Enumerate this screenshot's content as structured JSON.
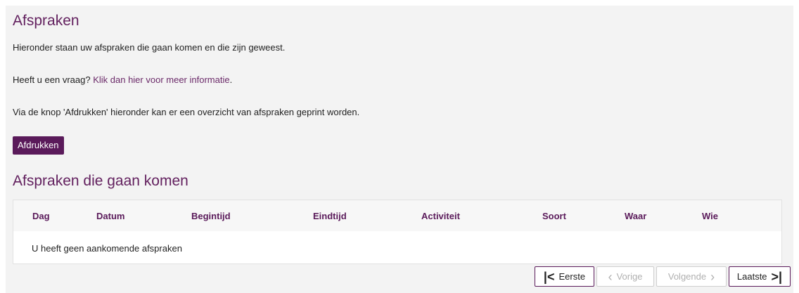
{
  "page": {
    "title": "Afspraken",
    "intro": "Hieronder staan uw afspraken die gaan komen en die zijn geweest.",
    "question_prefix": "Heeft u een vraag? ",
    "question_link": "Klik dan hier voor meer informatie",
    "question_suffix": ".",
    "print_info": "Via de knop 'Afdrukken' hieronder kan er een overzicht van afspraken geprint worden.",
    "print_button": "Afdrukken"
  },
  "upcoming": {
    "title": "Afspraken die gaan komen",
    "columns": [
      "Dag",
      "Datum",
      "Begintijd",
      "Eindtijd",
      "Activiteit",
      "Soort",
      "Waar",
      "Wie"
    ],
    "empty_message": "U heeft geen aankomende afspraken"
  },
  "pagination": {
    "first": "Eerste",
    "previous": "Vorige",
    "next": "Volgende",
    "last": "Laatste",
    "first_icon": "first-page-icon",
    "previous_icon": "chevron-left-icon",
    "next_icon": "chevron-right-icon",
    "last_icon": "last-page-icon"
  },
  "colors": {
    "accent": "#63215f",
    "button": "#5a1a5a",
    "panel_bg": "#f3f3f3"
  }
}
